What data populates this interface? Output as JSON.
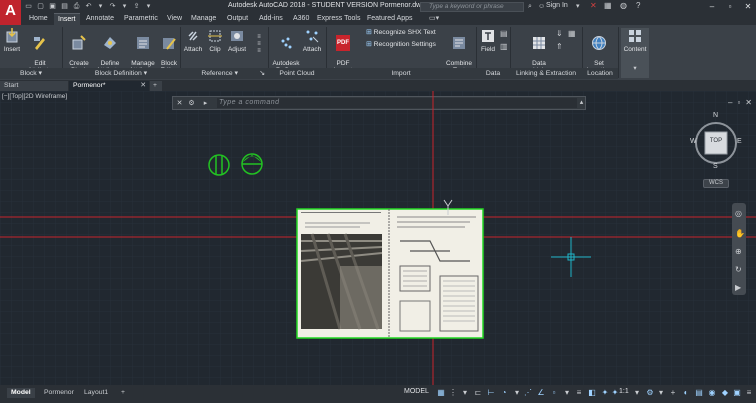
{
  "titlebar": {
    "title": "Autodesk AutoCAD 2018 - STUDENT VERSION    Pormenor.dwg",
    "search_placeholder": "Type a keyword or phrase",
    "sign_in": "Sign In",
    "logo": "A"
  },
  "ribbon_tabs": [
    "Home",
    "Insert",
    "Annotate",
    "Parametric",
    "View",
    "Manage",
    "Output",
    "Add-ins",
    "A360",
    "Express Tools",
    "Featured Apps"
  ],
  "ribbon": {
    "block": {
      "insert": "Insert",
      "edit_attribute": "Edit\nAttribute",
      "label": "Block"
    },
    "block_definition": {
      "create_block": "Create\nBlock",
      "define_attributes": "Define\nAttributes",
      "manage_attributes": "Manage\nAttributes",
      "block_editor": "Block\nEditor",
      "label": "Block Definition"
    },
    "reference": {
      "attach": "Attach",
      "clip": "Clip",
      "adjust": "Adjust",
      "label": "Reference"
    },
    "point_cloud": {
      "recap": "Autodesk\nReCap",
      "attach": "Attach",
      "label": "Point Cloud"
    },
    "import": {
      "pdf_import": "PDF\nImport",
      "recognize_shx": "Recognize SHX Text",
      "recognition_settings": "Recognition Settings",
      "combine_text": "Combine\nText",
      "label": "Import",
      "pdf_badge": "PDF"
    },
    "data": {
      "field": "Field",
      "label": "Data"
    },
    "linking": {
      "data_link": "Data\nLink",
      "label": "Linking & Extraction"
    },
    "location": {
      "set_location": "Set\nLocation",
      "label": "Location"
    },
    "content": {
      "content": "Content"
    }
  },
  "doc_tabs": {
    "start": "Start",
    "active": "Pormenor*",
    "add": "+"
  },
  "canvas": {
    "viewport_label": "[−][Top][2D Wireframe]",
    "command_placeholder": "Type  a  command",
    "viewcube": {
      "top": "TOP",
      "n": "N",
      "s": "S",
      "e": "E",
      "w": "W",
      "wcs": "WCS"
    }
  },
  "status": {
    "layout_tabs": [
      "Model",
      "Pormenor",
      "Layout1"
    ],
    "add": "+",
    "model": "MODEL",
    "scale": "1:1"
  },
  "colors": {
    "canvas_bg": "#212830",
    "ribbon_bg": "#3b4148",
    "crosshair_red": "#c8242c",
    "ucs_green": "#22c222",
    "cursor_cyan": "#1fb5c8",
    "logo_red": "#c0242d"
  }
}
